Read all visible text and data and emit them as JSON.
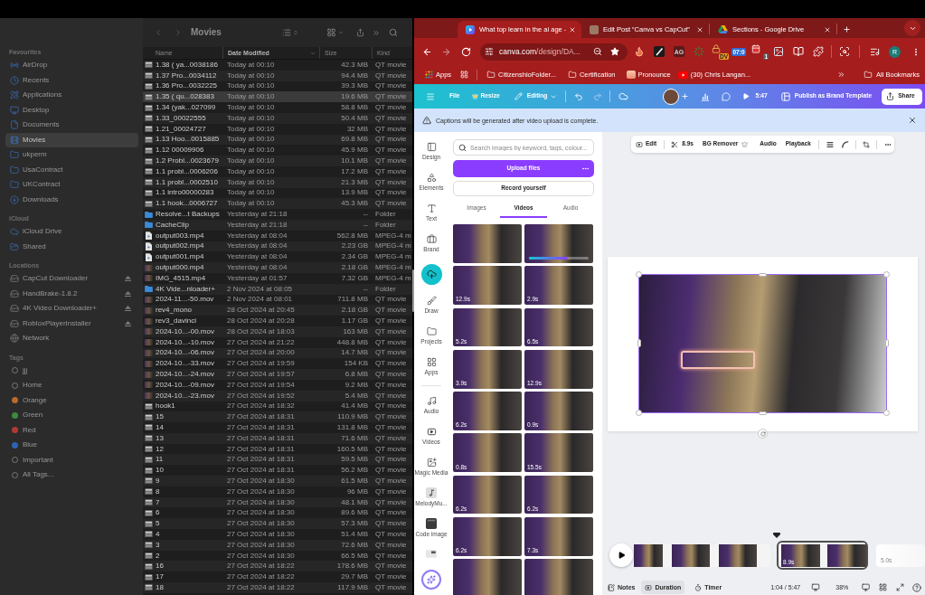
{
  "finder": {
    "sidebar": [
      {
        "title": "Favourites",
        "items": [
          {
            "label": "AirDrop",
            "kind": "airdrop",
            "selected": false
          },
          {
            "label": "Recents",
            "kind": "recents",
            "selected": false
          },
          {
            "label": "Applications",
            "kind": "applications",
            "selected": false
          },
          {
            "label": "Desktop",
            "kind": "desktop",
            "selected": false
          },
          {
            "label": "Documents",
            "kind": "documents",
            "selected": false
          },
          {
            "label": "Movies",
            "kind": "movies",
            "selected": true
          },
          {
            "label": "ukperm",
            "kind": "folder",
            "selected": false
          },
          {
            "label": "UsaContract",
            "kind": "folder",
            "selected": false
          },
          {
            "label": "UKContract",
            "kind": "folder",
            "selected": false
          },
          {
            "label": "Downloads",
            "kind": "downloads",
            "selected": false
          }
        ]
      },
      {
        "title": "iCloud",
        "items": [
          {
            "label": "iCloud Drive",
            "kind": "cloud",
            "selected": false
          },
          {
            "label": "Shared",
            "kind": "shared",
            "selected": false
          }
        ]
      },
      {
        "title": "Locations",
        "items": [
          {
            "label": "CapCut Downloader",
            "kind": "drive",
            "selected": false
          },
          {
            "label": "HandBrake-1.8.2",
            "kind": "drive",
            "selected": false
          },
          {
            "label": "4K Video Downloader+",
            "kind": "drive",
            "selected": false
          },
          {
            "label": "RobloxPlayerInstaller",
            "kind": "drive",
            "selected": false
          },
          {
            "label": "Network",
            "kind": "network",
            "selected": false
          }
        ]
      },
      {
        "title": "Tags",
        "items": [
          {
            "label": "jjj",
            "kind": "tag",
            "selected": false
          },
          {
            "label": "Home",
            "kind": "tag",
            "selected": false
          },
          {
            "label": "Orange",
            "kind": "tag",
            "color": "#b8692b",
            "selected": false
          },
          {
            "label": "Green",
            "kind": "tag",
            "color": "#3d8a3f",
            "selected": false
          },
          {
            "label": "Red",
            "kind": "tag",
            "color": "#b33a33",
            "selected": false
          },
          {
            "label": "Blue",
            "kind": "tag",
            "color": "#2c64b3",
            "selected": false
          },
          {
            "label": "Important",
            "kind": "tag",
            "selected": false
          },
          {
            "label": "All Tags...",
            "kind": "all_tags",
            "selected": false
          }
        ]
      }
    ],
    "toolbar": {
      "title": "Movies"
    },
    "columns": [
      {
        "label": "Name",
        "sorted": false
      },
      {
        "label": "Date Modified",
        "sorted": true
      },
      {
        "label": "Size",
        "sorted": false
      },
      {
        "label": "Kind",
        "sorted": false
      }
    ],
    "rows": [
      {
        "kind": "movie",
        "cells": [
          "1.38 ( ya...0038186",
          "Today at 00:10",
          "42.3 MB",
          "QT movie"
        ],
        "selected": false
      },
      {
        "kind": "movie",
        "cells": [
          "1.37 Pro...0034112",
          "Today at 00:10",
          "94.4 MB",
          "QT movie"
        ],
        "selected": false
      },
      {
        "kind": "movie",
        "cells": [
          "1.36 Pro...0032225",
          "Today at 00:10",
          "39.3 MB",
          "QT movie"
        ],
        "selected": false
      },
      {
        "kind": "movie",
        "cells": [
          "1.35 ( qu...028383",
          "Today at 00:10",
          "19.6 MB",
          "QT movie"
        ],
        "selected": true
      },
      {
        "kind": "movie",
        "cells": [
          "1.34 (yak...027099",
          "Today at 00:10",
          "58.8 MB",
          "QT movie"
        ],
        "selected": false
      },
      {
        "kind": "movie",
        "cells": [
          "1.33_00022555",
          "Today at 00:10",
          "50.4 MB",
          "QT movie"
        ],
        "selected": false
      },
      {
        "kind": "movie",
        "cells": [
          "1.21_00024727",
          "Today at 00:10",
          "32 MB",
          "QT movie"
        ],
        "selected": false
      },
      {
        "kind": "movie",
        "cells": [
          "1.13 Hoo...0015885",
          "Today at 00:10",
          "69.8 MB",
          "QT movie"
        ],
        "selected": false
      },
      {
        "kind": "movie",
        "cells": [
          "1.12 00009906",
          "Today at 00:10",
          "45.9 MB",
          "QT movie"
        ],
        "selected": false
      },
      {
        "kind": "movie",
        "cells": [
          "1.2 Probl...0023679",
          "Today at 00:10",
          "10.1 MB",
          "QT movie"
        ],
        "selected": false
      },
      {
        "kind": "movie",
        "cells": [
          "1.1 probl...0006206",
          "Today at 00:10",
          "17.2 MB",
          "QT movie"
        ],
        "selected": false
      },
      {
        "kind": "movie",
        "cells": [
          "1.1 probl...0002510",
          "Today at 00:10",
          "21.3 MB",
          "QT movie"
        ],
        "selected": false
      },
      {
        "kind": "movie",
        "cells": [
          "1.1 intro00000283",
          "Today at 00:10",
          "13.9 MB",
          "QT movie"
        ],
        "selected": false
      },
      {
        "kind": "movie",
        "cells": [
          "1.1 hook...0006727",
          "Today at 00:10",
          "45.3 MB",
          "QT movie"
        ],
        "selected": false
      },
      {
        "kind": "folder",
        "cells": [
          "Resolve...t Backups",
          "Yesterday at 21:18",
          "--",
          "Folder"
        ],
        "selected": false
      },
      {
        "kind": "folder",
        "cells": [
          "CacheClip",
          "Yesterday at 21:18",
          "--",
          "Folder"
        ],
        "selected": false
      },
      {
        "kind": "document",
        "cells": [
          "output003.mp4",
          "Yesterday at 08:04",
          "562.8 MB",
          "MPEG-4 m"
        ],
        "selected": false
      },
      {
        "kind": "document",
        "cells": [
          "output002.mp4",
          "Yesterday at 08:04",
          "2.23 GB",
          "MPEG-4 m"
        ],
        "selected": false
      },
      {
        "kind": "document",
        "cells": [
          "output001.mp4",
          "Yesterday at 08:04",
          "2.34 GB",
          "MPEG-4 m"
        ],
        "selected": false
      },
      {
        "kind": "video",
        "cells": [
          "output000.mp4",
          "Yesterday at 08:04",
          "2.18 GB",
          "MPEG-4 m"
        ],
        "selected": false
      },
      {
        "kind": "video",
        "cells": [
          "IMG_4515.mp4",
          "Yesterday at 01:57",
          "7.32 GB",
          "MPEG-4 m"
        ],
        "selected": false
      },
      {
        "kind": "folder",
        "cells": [
          "4K Vide...nloader+",
          "2 Nov 2024 at 08:05",
          "--",
          "Folder"
        ],
        "selected": false
      },
      {
        "kind": "video",
        "cells": [
          "2024-11...-50.mov",
          "2 Nov 2024 at 08:01",
          "711.8 MB",
          "QT movie"
        ],
        "selected": false
      },
      {
        "kind": "video",
        "cells": [
          "rev4_mono",
          "28 Oct 2024 at 20:45",
          "2.18 GB",
          "QT movie"
        ],
        "selected": false
      },
      {
        "kind": "video",
        "cells": [
          "rev3_davinci",
          "28 Oct 2024 at 20:28",
          "1.17 GB",
          "QT movie"
        ],
        "selected": false
      },
      {
        "kind": "video",
        "cells": [
          "2024-10...-00.mov",
          "28 Oct 2024 at 18:03",
          "163 MB",
          "QT movie"
        ],
        "selected": false
      },
      {
        "kind": "video",
        "cells": [
          "2024-10...-10.mov",
          "27 Oct 2024 at 21:22",
          "448.8 MB",
          "QT movie"
        ],
        "selected": false
      },
      {
        "kind": "video",
        "cells": [
          "2024-10...-06.mov",
          "27 Oct 2024 at 20:00",
          "14.7 MB",
          "QT movie"
        ],
        "selected": false
      },
      {
        "kind": "video",
        "cells": [
          "2024-10...-33.mov",
          "27 Oct 2024 at 19:59",
          "154 KB",
          "QT movie"
        ],
        "selected": false
      },
      {
        "kind": "video",
        "cells": [
          "2024-10...-24.mov",
          "27 Oct 2024 at 19:57",
          "6.8 MB",
          "QT movie"
        ],
        "selected": false
      },
      {
        "kind": "video",
        "cells": [
          "2024-10...-09.mov",
          "27 Oct 2024 at 19:54",
          "9.2 MB",
          "QT movie"
        ],
        "selected": false
      },
      {
        "kind": "video",
        "cells": [
          "2024-10...-23.mov",
          "27 Oct 2024 at 19:52",
          "5.4 MB",
          "QT movie"
        ],
        "selected": false
      },
      {
        "kind": "movie",
        "cells": [
          "hook1",
          "27 Oct 2024 at 18:32",
          "41.4 MB",
          "QT movie"
        ],
        "selected": false
      },
      {
        "kind": "movie",
        "cells": [
          "15",
          "27 Oct 2024 at 18:31",
          "110.9 MB",
          "QT movie"
        ],
        "selected": false
      },
      {
        "kind": "movie",
        "cells": [
          "14",
          "27 Oct 2024 at 18:31",
          "131.8 MB",
          "QT movie"
        ],
        "selected": false
      },
      {
        "kind": "movie",
        "cells": [
          "13",
          "27 Oct 2024 at 18:31",
          "71.6 MB",
          "QT movie"
        ],
        "selected": false
      },
      {
        "kind": "movie",
        "cells": [
          "12",
          "27 Oct 2024 at 18:31",
          "160.5 MB",
          "QT movie"
        ],
        "selected": false
      },
      {
        "kind": "movie",
        "cells": [
          "11",
          "27 Oct 2024 at 18:31",
          "59.5 MB",
          "QT movie"
        ],
        "selected": false
      },
      {
        "kind": "movie",
        "cells": [
          "10",
          "27 Oct 2024 at 18:31",
          "56.2 MB",
          "QT movie"
        ],
        "selected": false
      },
      {
        "kind": "movie",
        "cells": [
          "9",
          "27 Oct 2024 at 18:30",
          "61.5 MB",
          "QT movie"
        ],
        "selected": false
      },
      {
        "kind": "movie",
        "cells": [
          "8",
          "27 Oct 2024 at 18:30",
          "96 MB",
          "QT movie"
        ],
        "selected": false
      },
      {
        "kind": "movie",
        "cells": [
          "7",
          "27 Oct 2024 at 18:30",
          "48.1 MB",
          "QT movie"
        ],
        "selected": false
      },
      {
        "kind": "movie",
        "cells": [
          "6",
          "27 Oct 2024 at 18:30",
          "89.6 MB",
          "QT movie"
        ],
        "selected": false
      },
      {
        "kind": "movie",
        "cells": [
          "5",
          "27 Oct 2024 at 18:30",
          "57.3 MB",
          "QT movie"
        ],
        "selected": false
      },
      {
        "kind": "movie",
        "cells": [
          "4",
          "27 Oct 2024 at 18:30",
          "51.4 MB",
          "QT movie"
        ],
        "selected": false
      },
      {
        "kind": "movie",
        "cells": [
          "3",
          "27 Oct 2024 at 18:30",
          "72.6 MB",
          "QT movie"
        ],
        "selected": false
      },
      {
        "kind": "movie",
        "cells": [
          "2",
          "27 Oct 2024 at 18:30",
          "66.5 MB",
          "QT movie"
        ],
        "selected": false
      },
      {
        "kind": "movie",
        "cells": [
          "16",
          "27 Oct 2024 at 18:22",
          "178.6 MB",
          "QT movie"
        ],
        "selected": false
      },
      {
        "kind": "movie",
        "cells": [
          "17",
          "27 Oct 2024 at 18:22",
          "29.7 MB",
          "QT movie"
        ],
        "selected": false
      },
      {
        "kind": "movie",
        "cells": [
          "18",
          "27 Oct 2024 at 18:22",
          "117.9 MB",
          "QT movie"
        ],
        "selected": false
      }
    ]
  },
  "browser": {
    "tabs": [
      {
        "kind": "canva",
        "title": "What top learn in the ai age -",
        "selected": true
      },
      {
        "kind": "photo",
        "title": "Edit Post “Canva vs CapCut”",
        "selected": false
      },
      {
        "kind": "drive",
        "title": "Sections - Google Drive",
        "selected": false
      }
    ],
    "address": {
      "host": "canva.com",
      "path": "/design/DA..."
    },
    "extensions": [
      {
        "kind": "flame"
      },
      {
        "kind": "slash"
      },
      {
        "kind": "text",
        "label": "AG"
      },
      {
        "kind": "loader"
      },
      {
        "kind": "lock",
        "badge": "DV"
      },
      {
        "kind": "clock",
        "badge": "07:0"
      },
      {
        "kind": "calendar",
        "badge": "1"
      },
      {
        "kind": "image"
      },
      {
        "kind": "book"
      },
      {
        "kind": "puzzle"
      }
    ],
    "profile": "R",
    "bookmarks": [
      {
        "kind": "apps",
        "label": "Apps"
      },
      {
        "kind": "grid"
      },
      {
        "kind": "folder",
        "label": "CitizenshioFolder..."
      },
      {
        "kind": "folder",
        "label": "Certification"
      },
      {
        "kind": "site",
        "label": "Pronounce"
      },
      {
        "kind": "youtube",
        "label": "(30) Chris Langan..."
      }
    ],
    "all_bookmarks": "All Bookmarks"
  },
  "canva": {
    "header": {
      "file": "File",
      "resize": "Resize",
      "mode": "Editing",
      "duration": "5:47",
      "publish": "Publish as Brand Template",
      "share": "Share"
    },
    "notice": "Captions will be generated after video upload is complete.",
    "rail": {
      "top": [
        {
          "kind": "design",
          "label": "Design",
          "selected": false
        },
        {
          "kind": "elements",
          "label": "Elements",
          "selected": false
        },
        {
          "kind": "text",
          "label": "Text",
          "selected": false
        },
        {
          "kind": "brand",
          "label": "Brand",
          "selected": false
        },
        {
          "kind": "uploads",
          "selected": true
        },
        {
          "kind": "draw",
          "label": "Draw",
          "selected": false
        },
        {
          "kind": "projects",
          "label": "Projects",
          "selected": false
        },
        {
          "kind": "apps",
          "label": "Apps",
          "selected": false
        }
      ],
      "bottom": [
        {
          "kind": "audio",
          "label": "Audio",
          "selected": false
        },
        {
          "kind": "videos",
          "label": "Videos",
          "selected": false
        },
        {
          "kind": "magic_media",
          "label": "Magic Media",
          "selected": false
        },
        {
          "kind": "melody",
          "label": "MelodyMu...",
          "selected": false
        },
        {
          "kind": "code",
          "label": "Code image",
          "selected": false
        },
        {
          "kind": "app_tile",
          "selected": false
        }
      ]
    },
    "panel": {
      "search_placeholder": "Search images by keyword, tags, colour...",
      "upload": "Upload files",
      "record": "Record yourself",
      "tabs": [
        {
          "label": "Images",
          "selected": false
        },
        {
          "label": "Videos",
          "selected": true
        },
        {
          "label": "Audio",
          "selected": false
        }
      ],
      "videos": [
        {
          "kind": "clip"
        },
        {
          "kind": "uploading",
          "level": 0.65
        },
        {
          "kind": "clip",
          "duration": "12.9s"
        },
        {
          "kind": "clip",
          "duration": "2.9s"
        },
        {
          "kind": "clip",
          "duration": "5.2s"
        },
        {
          "kind": "clip",
          "duration": "6.5s"
        },
        {
          "kind": "clip",
          "duration": "3.9s"
        },
        {
          "kind": "clip",
          "duration": "12.9s"
        },
        {
          "kind": "clip",
          "duration": "6.2s"
        },
        {
          "kind": "clip",
          "duration": "0.9s"
        },
        {
          "kind": "clip",
          "duration": "0.8s"
        },
        {
          "kind": "clip",
          "duration": "15.5s"
        },
        {
          "kind": "clip",
          "duration": "6.2s"
        },
        {
          "kind": "clip",
          "duration": "6.2s"
        },
        {
          "kind": "clip",
          "duration": "6.2s"
        },
        {
          "kind": "clip",
          "duration": "7.3s"
        },
        {
          "kind": "clip"
        },
        {
          "kind": "clip"
        }
      ]
    },
    "toolbar": {
      "edit": "Edit",
      "trim": "8.9s",
      "bg_remover": "BG Remover",
      "audio": "Audio",
      "playback": "Playback"
    },
    "clips": [
      {
        "kind": "video",
        "selected": false
      },
      {
        "kind": "video",
        "duration": "8.9s",
        "selected": true
      },
      {
        "kind": "blank",
        "duration": "5.0s",
        "selected": false
      }
    ],
    "footer": {
      "tools": [
        {
          "kind": "notes",
          "label": "Notes",
          "selected": false
        },
        {
          "kind": "duration",
          "label": "Duration",
          "selected": true
        },
        {
          "kind": "timer",
          "label": "Timer",
          "selected": false
        }
      ],
      "time": "1:04 / 5:47",
      "zoom": "38%"
    }
  }
}
